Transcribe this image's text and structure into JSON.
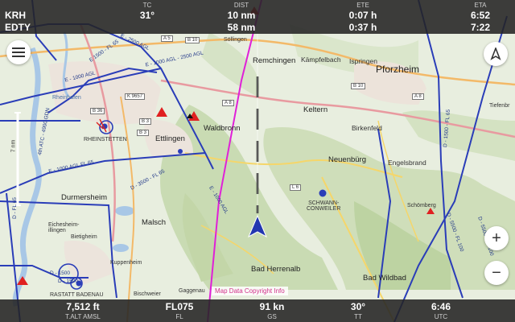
{
  "topbar": {
    "waypoints": [
      "KRH",
      "EDTY"
    ],
    "cells": [
      {
        "label": "TC",
        "values": [
          "31°"
        ]
      },
      {
        "label": "DIST",
        "values": [
          "10 nm",
          "58 nm"
        ]
      },
      {
        "label": "ETE",
        "values": [
          "0:07 h",
          "0:37 h"
        ]
      },
      {
        "label": "ETA",
        "values": [
          "6:52",
          "7:22"
        ]
      }
    ]
  },
  "bottombar": {
    "cells": [
      {
        "label": "T.ALT AMSL",
        "value": "7,512 ft"
      },
      {
        "label": "FL",
        "value": "FL075"
      },
      {
        "label": "GS",
        "value": "91 kn"
      },
      {
        "label": "TT",
        "value": "30°"
      },
      {
        "label": "UTC",
        "value": "6:46"
      }
    ]
  },
  "map": {
    "copyright": "Map Data Copyright Info",
    "towns": {
      "pforzheim": "Pforzheim",
      "remchingen": "Remchingen",
      "kampfelbach": "Kämpfelbach",
      "ispringen": "Ispringen",
      "keltern": "Keltern",
      "birkenfeld": "Birkenfeld",
      "neuenbug": "Neuenbürg",
      "engelsbrand": "Engelsbrand",
      "waldbronn": "Waldbronn",
      "ettlingen": "Ettlingen",
      "rheinstetten": "RHEINSTETTEN",
      "durmersheim": "Durmersheim",
      "malsch": "Malsch",
      "schwann": "SCHWANN-\nCONWEILER",
      "schomberg": "Schömberg",
      "badherrenalb": "Bad Herrenalb",
      "badwildbad": "Bad Wildbad",
      "rastatt": "RASTATT BADENAU",
      "solingen": "Söllingen",
      "eichesheim": "Eichesheim-\nillingen",
      "bietigheim": "Bietigheim",
      "kuppenheim": "Kuppenheim",
      "bischweier": "Bischweier",
      "rheinhafen": "Rheinhafen",
      "tiefenbronn": "Tiefenbr",
      "gaggenau": "Gaggenau"
    },
    "airspace_labels": [
      "E 1500 - FL 65",
      "E - 2500 AGL",
      "E - 1000 AGL - 2500 AGL",
      "E - 1000 AGL",
      "E - 1000 AGL FL 65",
      "D - 3500 - FL 65",
      "E - 1000 AGL",
      "D - 1500 - FL 65",
      "D - 5500 - FL 100",
      "D - 5500 - FL 100",
      "D - FL 65",
      "4th ATC - 4900 GDN",
      "D - 1500",
      "D - 1500"
    ],
    "road_labels": [
      "A 5",
      "B 10",
      "A 8",
      "B 36",
      "K 9657",
      "B 3",
      "B 3",
      "B 10",
      "A 8",
      "L 6"
    ],
    "scale_label": "7 nm"
  },
  "controls": {
    "menu_icon": "menu-icon",
    "north_icon": "north-up-icon",
    "zoom_in": "+",
    "zoom_out": "−"
  },
  "colors": {
    "airspace_blue": "#2a3db8",
    "route_magenta": "#e020d8",
    "warning_red": "#e02020",
    "bar_bg": "#232323"
  }
}
